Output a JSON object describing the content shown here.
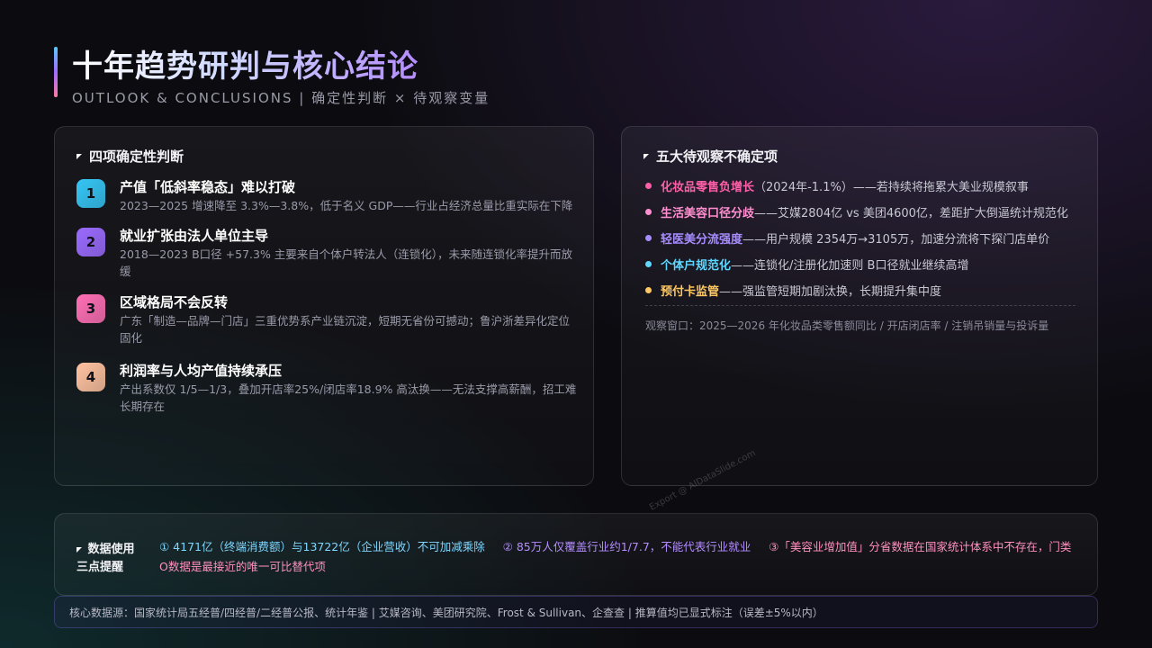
{
  "header": {
    "title": "十年趋势研判与核心结论",
    "subtitle": "OUTLOOK & CONCLUSIONS  |  确定性判断 × 待观察变量"
  },
  "left_panel": {
    "heading": "四项确定性判断",
    "items": [
      {
        "num": "1",
        "title": "产值「低斜率稳态」难以打破",
        "desc": "2023—2025 增速降至 3.3%—3.8%，低于名义 GDP——行业占经济总量比重实际在下降",
        "color": "#35c6f5"
      },
      {
        "num": "2",
        "title": "就业扩张由法人单位主导",
        "desc": "2018—2023 B口径 +57.3% 主要来自个体户转法人（连锁化），未来随连锁化率提升而放缓",
        "color": "#9b6bff"
      },
      {
        "num": "3",
        "title": "区域格局不会反转",
        "desc": "广东「制造—品牌—门店」三重优势系产业链沉淀，短期无省份可撼动；鲁沪浙差异化定位固化",
        "color": "#ff6fb5"
      },
      {
        "num": "4",
        "title": "利润率与人均产值持续承压",
        "desc": "产出系数仅 1/5—1/3，叠加开店率25%/闭店率18.9% 高汰换——无法支撑高薪酬，招工难长期存在",
        "color": "#ffc2a0"
      }
    ]
  },
  "right_panel": {
    "heading": "五大待观察不确定项",
    "items": [
      {
        "key": "化妆品零售负增长",
        "rest": "（2024年-1.1%）——若持续将拖累大美业规模叙事",
        "color": "#ff5fa8"
      },
      {
        "key": "生活美容口径分歧",
        "rest": "——艾媒2804亿 vs 美团4600亿，差距扩大倒逼统计规范化",
        "color": "#ff8fd0"
      },
      {
        "key": "轻医美分流强度",
        "rest": "——用户规模 2354万→3105万，加速分流将下探门店单价",
        "color": "#a68cff"
      },
      {
        "key": "个体户规范化",
        "rest": "——连锁化/注册化加速则 B口径就业继续高增",
        "color": "#5fd8ff"
      },
      {
        "key": "预付卡监管",
        "rest": "——强监管短期加剧汰换，长期提升集中度",
        "color": "#ffc860"
      }
    ],
    "window": "观察窗口：2025—2026 年化妆品类零售额同比 / 开店闭店率 / 注销吊销量与投诉量"
  },
  "reminder": {
    "heading": "数据使用三点提醒",
    "p1": "① 4171亿（终端消费额）与13722亿（企业营收）不可加减乘除",
    "p2": "② 85万人仅覆盖行业约1/7.7，不能代表行业就业",
    "p3": "③「美容业增加值」分省数据在国家统计体系中不存在，门类O数据是最接近的唯一可比替代项"
  },
  "source": {
    "text": "核心数据源：国家统计局五经普/四经普/二经普公报、统计年鉴  |  艾媒咨询、美团研究院、Frost & Sullivan、企查查  |  推算值均已显式标注（误差±5%以内）"
  },
  "watermark": "Export @ AIDataSlide.com"
}
